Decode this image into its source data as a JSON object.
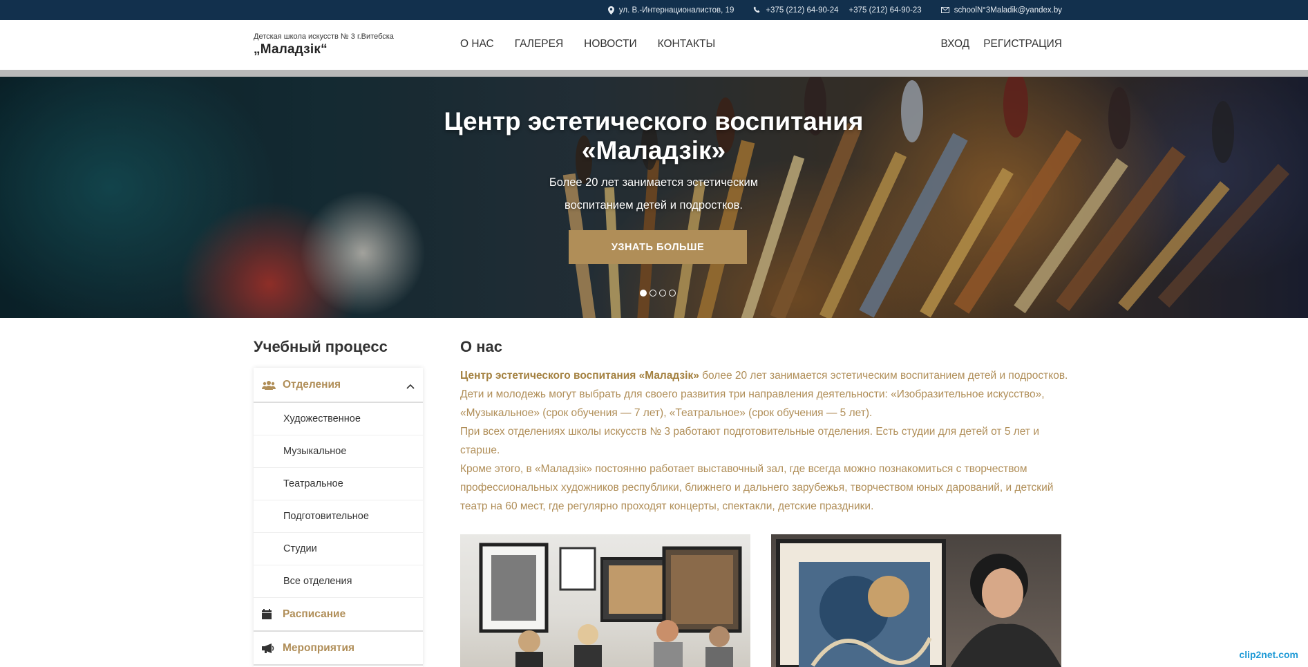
{
  "topbar": {
    "address": "ул. В.-Интернационалистов, 19",
    "phone1": "+375 (212) 64-90-24",
    "phone2": "+375 (212) 64-90-23",
    "email": "schoolN°3Maladik@yandex.by"
  },
  "header": {
    "logo_small": "Детская школа искусств № 3 г.Витебска",
    "logo_big": "„Маладзік“",
    "nav": [
      "О НАС",
      "ГАЛЕРЕЯ",
      "НОВОСТИ",
      "КОНТАКТЫ"
    ],
    "login": "ВХОД",
    "register": "РЕГИСТРАЦИЯ"
  },
  "hero": {
    "title_line1": "Центр эстетического воспитания",
    "title_line2": "«Маладзік»",
    "sub_line1": "Более 20 лет занимается эстетическим",
    "sub_line2": "воспитанием детей и подростков.",
    "button": "УЗНАТЬ БОЛЬШЕ",
    "slide_count": 4,
    "active_slide": 1
  },
  "sidebar": {
    "title": "Учебный процесс",
    "section": "Отделения",
    "items": [
      "Художественное",
      "Музыкальное",
      "Театральное",
      "Подготовительное",
      "Студии",
      "Все отделения"
    ],
    "schedule": "Расписание",
    "events": "Мероприятия"
  },
  "about": {
    "title": "О нас",
    "lead_bold": "Центр эстетического воспитания «Маладзік»",
    "lead_rest": " более 20 лет занимается эстетическим воспитанием детей и подростков.",
    "p2": "Дети и молодежь могут выбрать для своего развития три направления деятельности: «Изобразительное искусство», «Музыкальное» (срок обучения — 7 лет), «Театральное» (срок обучения — 5 лет).",
    "p3": "При всех отделениях школы искусств № 3 работают подготовительные отделения. Есть студии для детей от 5 лет и старше.",
    "p4": "Кроме этого, в «Маладзік» постоянно работает выставочный зал, где всегда можно познакомиться с творчеством профессиональных художников республики, ближнего и дальнего зарубежья, творчеством юных дарований, и детский театр на 60 мест, где регулярно проходят концерты, спектакли, детские праздники."
  },
  "watermark": "clip2net.com",
  "colors": {
    "accent": "#b08e58",
    "topbar": "#12304d"
  }
}
